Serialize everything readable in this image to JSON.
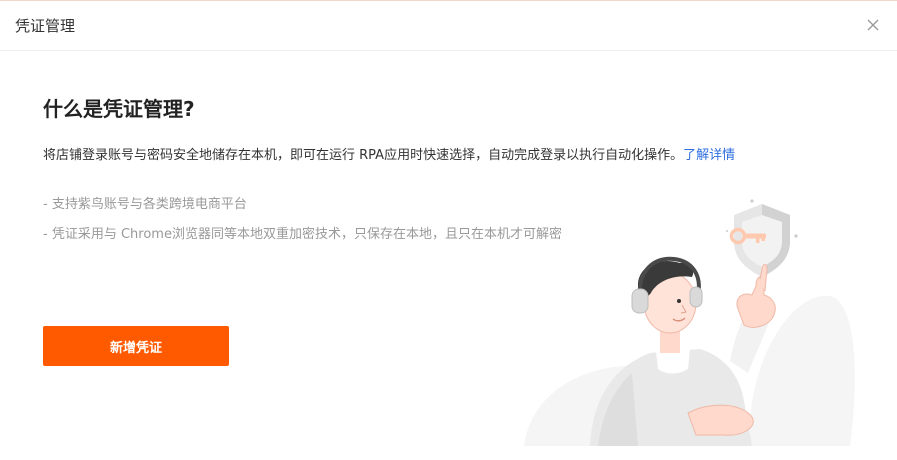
{
  "dialog": {
    "title": "凭证管理"
  },
  "content": {
    "heading": "什么是凭证管理?",
    "description": "将店铺登录账号与密码安全地储存在本机，即可在运行 RPA应用时快速选择，自动完成登录以执行自动化操作。",
    "learn_more": "了解详情",
    "bullets": [
      "- 支持紫鸟账号与各类跨境电商平台",
      "- 凭证采用与 Chrome浏览器同等本地双重加密技术，只保存在本地，且只在本机才可解密"
    ]
  },
  "actions": {
    "add_label": "新增凭证"
  },
  "colors": {
    "primary": "#ff5a00",
    "link": "#2f6fe0",
    "muted_text": "#999999"
  },
  "icons": {
    "close": "close-icon",
    "illustration": "security-illustration"
  }
}
